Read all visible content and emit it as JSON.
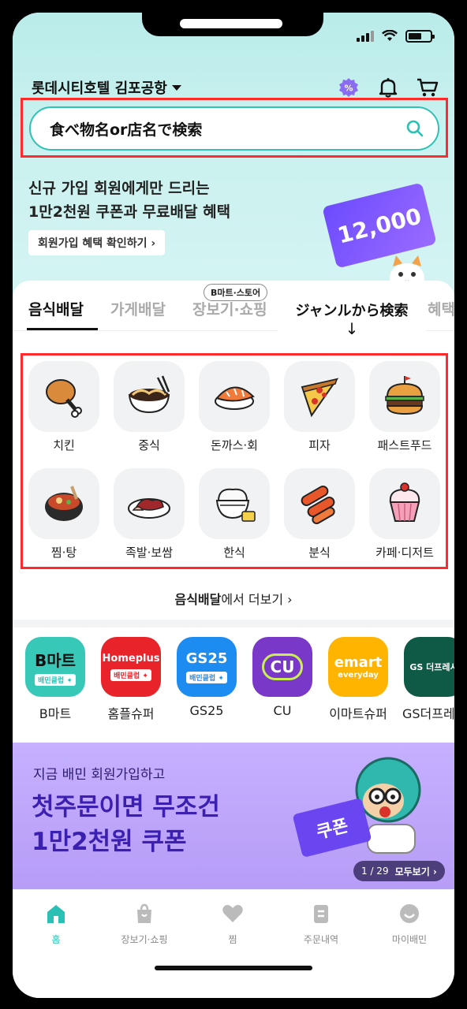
{
  "status": {
    "icons": [
      "signal-icon",
      "wifi-icon",
      "battery-icon"
    ]
  },
  "header": {
    "location": "롯데시티호텔 김포공항",
    "icons": [
      "percent-badge-icon",
      "bell-icon",
      "cart-icon"
    ]
  },
  "search": {
    "placeholder": "食べ物名or店名で検索"
  },
  "promo": {
    "line1": "신규 가입 회원에게만 드리는",
    "line2": "1만2천원 쿠폰과 무료배달 혜택",
    "button": "회원가입 혜택 확인하기 ›",
    "ticket_value": "12,000"
  },
  "tabs": {
    "items": [
      "음식배달",
      "가게배달",
      "장보기·쇼핑",
      "혜택"
    ],
    "badge": "B마트·스토어",
    "annotation": "ジャンルから検索",
    "annotation_arrow": "↓"
  },
  "categories": [
    {
      "label": "치킨",
      "icon": "chicken-icon"
    },
    {
      "label": "중식",
      "icon": "noodle-bowl-icon"
    },
    {
      "label": "돈까스·회",
      "icon": "sushi-icon"
    },
    {
      "label": "피자",
      "icon": "pizza-icon"
    },
    {
      "label": "패스트푸드",
      "icon": "burger-icon"
    },
    {
      "label": "찜·탕",
      "icon": "stew-pot-icon"
    },
    {
      "label": "족발·보쌈",
      "icon": "pork-plate-icon"
    },
    {
      "label": "한식",
      "icon": "rice-bowl-icon"
    },
    {
      "label": "분식",
      "icon": "tteokbokki-icon"
    },
    {
      "label": "카페·디저트",
      "icon": "cupcake-icon"
    }
  ],
  "more": {
    "bold": "음식배달",
    "rest": "에서 더보기 ›"
  },
  "stores": [
    {
      "name": "B마트",
      "logo": "B마트",
      "sub": "배민클럽 ✦",
      "color": "#38c8b8"
    },
    {
      "name": "홈플슈퍼",
      "logo": "Homeplus",
      "sub": "배민클럽 ✦",
      "color": "#e8232a"
    },
    {
      "name": "GS25",
      "logo": "GS25",
      "sub": "배민클럽 ✦",
      "color": "#1c8cf0"
    },
    {
      "name": "CU",
      "logo": "CU",
      "sub": "",
      "color": "#7a38c8"
    },
    {
      "name": "이마트슈퍼",
      "logo": "emart",
      "sub": "everyday",
      "color": "#ffb400"
    },
    {
      "name": "GS더프레시",
      "logo": "GS 더프레시",
      "sub": "",
      "color": "#0e5a46"
    }
  ],
  "banner": {
    "line1": "지금 배민 회원가입하고",
    "line2": "첫주문이면 무조건",
    "line3": "1만2천원 쿠폰",
    "coupon": "쿠폰",
    "page": "1 / 29",
    "see_all": "모두보기 ›"
  },
  "nav": [
    {
      "label": "홈",
      "icon": "home-icon",
      "active": true
    },
    {
      "label": "장보기·쇼핑",
      "icon": "shopping-bag-icon",
      "active": false
    },
    {
      "label": "찜",
      "icon": "heart-icon",
      "active": false
    },
    {
      "label": "주문내역",
      "icon": "receipt-icon",
      "active": false
    },
    {
      "label": "마이배민",
      "icon": "profile-icon",
      "active": false
    }
  ],
  "colors": {
    "accent": "#2ac1b4",
    "highlight": "#ff2a2a",
    "banner": "#b69cf6"
  }
}
